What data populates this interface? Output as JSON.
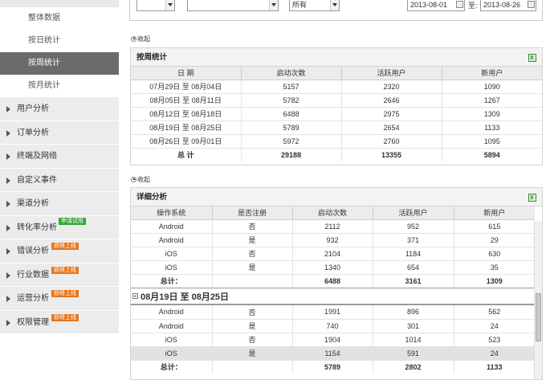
{
  "sidebar": {
    "sub_items": [
      {
        "label": "整体数据",
        "active": false
      },
      {
        "label": "按日统计",
        "active": false
      },
      {
        "label": "按周统计",
        "active": true
      },
      {
        "label": "按月统计",
        "active": false
      }
    ],
    "sections": [
      {
        "label": "用户分析",
        "badge": ""
      },
      {
        "label": "订单分析",
        "badge": ""
      },
      {
        "label": "终端及网络",
        "badge": ""
      },
      {
        "label": "自定义事件",
        "badge": ""
      },
      {
        "label": "渠道分析",
        "badge": ""
      },
      {
        "label": "转化率分析",
        "badge": "申请试用",
        "badge_color": "green"
      },
      {
        "label": "错误分析",
        "badge": "即将上线",
        "badge_color": "orange"
      },
      {
        "label": "行业数据",
        "badge": "即将上线",
        "badge_color": "orange"
      },
      {
        "label": "运营分析",
        "badge": "即将上线",
        "badge_color": "orange"
      },
      {
        "label": "权限管理",
        "badge": "即将上线",
        "badge_color": "orange"
      }
    ]
  },
  "filters": {
    "select1": "",
    "select2": "",
    "select3": "所有",
    "date_from": "2013-08-01",
    "to_label": "至:",
    "date_to": "2013-08-26"
  },
  "weekly": {
    "collapse_label": "收起",
    "title": "按周统计",
    "headers": [
      "日 期",
      "启动次数",
      "活跃用户",
      "新用户"
    ],
    "rows": [
      [
        "07月29日 至 08月04日",
        "5157",
        "2320",
        "1090"
      ],
      [
        "08月05日 至 08月11日",
        "5782",
        "2646",
        "1267"
      ],
      [
        "08月12日 至 08月18日",
        "6488",
        "2975",
        "1309"
      ],
      [
        "08月19日 至 08月25日",
        "5789",
        "2654",
        "1133"
      ],
      [
        "08月26日 至 09月01日",
        "5972",
        "2760",
        "1095"
      ]
    ],
    "total": [
      "总 计",
      "29188",
      "13355",
      "5894"
    ]
  },
  "detail": {
    "collapse_label": "收起",
    "title": "详细分析",
    "headers": [
      "操作系统",
      "是否注册",
      "启动次数",
      "活跃用户",
      "新用户"
    ],
    "group1_rows": [
      [
        "Android",
        "否",
        "2112",
        "952",
        "615"
      ],
      [
        "Android",
        "是",
        "932",
        "371",
        "29"
      ],
      [
        "iOS",
        "否",
        "2104",
        "1184",
        "630"
      ],
      [
        "iOS",
        "是",
        "1340",
        "654",
        "35"
      ]
    ],
    "group1_total": [
      "总计：",
      "",
      "6488",
      "3161",
      "1309"
    ],
    "group2_title": "08月19日 至 08月25日",
    "group2_rows": [
      [
        "Android",
        "否",
        "1991",
        "896",
        "562"
      ],
      [
        "Android",
        "是",
        "740",
        "301",
        "24"
      ],
      [
        "iOS",
        "否",
        "1904",
        "1014",
        "523"
      ],
      [
        "iOS",
        "是",
        "1154",
        "591",
        "24"
      ]
    ],
    "group2_total": [
      "总计：",
      "",
      "5789",
      "2802",
      "1133"
    ]
  }
}
